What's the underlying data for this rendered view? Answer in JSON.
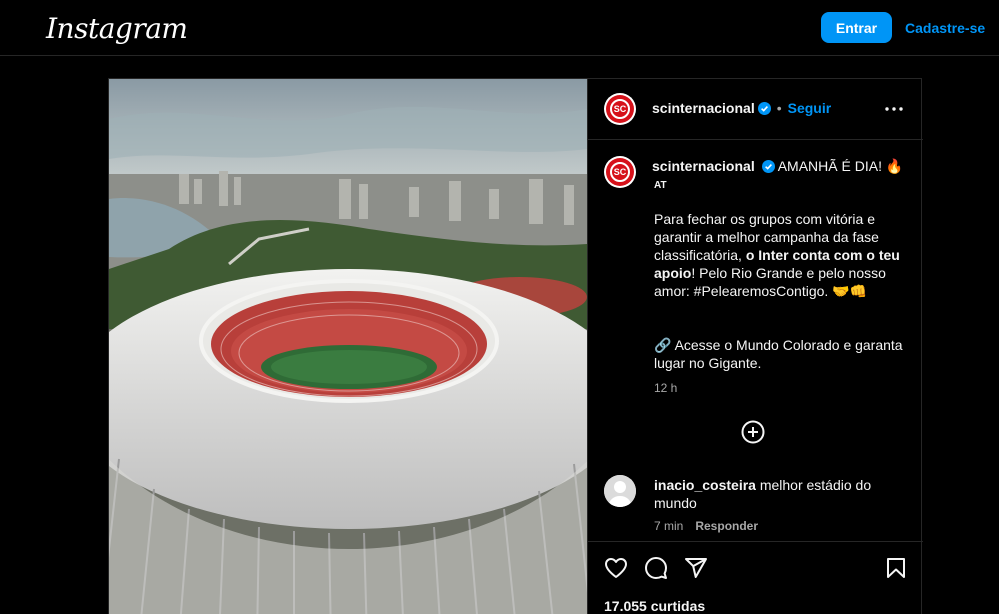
{
  "header": {
    "logo_text": "Instagram",
    "login_label": "Entrar",
    "signup_label": "Cadastre-se"
  },
  "post": {
    "author": "scinternacional",
    "follow_label": "Seguir",
    "separator": "•",
    "caption_headline": "AMANHÃ É DIA! 🔥",
    "caption_sub": "AT",
    "caption_part1": "Para fechar os grupos com vitória e garantir a melhor campanha da fase classificatória, ",
    "caption_bold": "o Inter conta com o teu apoio",
    "caption_part2": "! Pelo Rio Grande e pelo nosso amor: #PelearemosContigo. 🤝👊",
    "caption_link_icon": "🔗",
    "caption_p2": "Acesse o Mundo Colorado e garanta lugar no Gigante.",
    "time_ago": "12 h",
    "likes": "17.055 curtidas"
  },
  "comment": {
    "user": "inacio_costeira",
    "text": "melhor estádio do mundo",
    "time": "7 min",
    "reply_label": "Responder"
  },
  "colors": {
    "accent": "#0095f6",
    "brand_red": "#d6111a"
  },
  "icons": [
    "more-icon",
    "verified-icon",
    "add-comment-icon",
    "heart-icon",
    "comment-icon",
    "share-icon",
    "bookmark-icon"
  ]
}
